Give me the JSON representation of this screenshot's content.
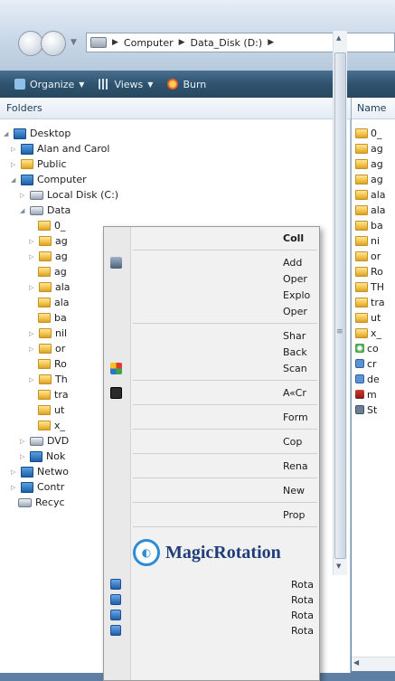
{
  "address": {
    "crumbs": [
      "Computer",
      "Data_Disk (D:)"
    ]
  },
  "toolbar": {
    "organize": "Organize",
    "views": "Views",
    "burn": "Burn"
  },
  "folders": {
    "header": "Folders",
    "tree": [
      {
        "label": "Desktop"
      },
      {
        "label": "Alan and Carol"
      },
      {
        "label": "Public"
      },
      {
        "label": "Computer"
      },
      {
        "label": "Local Disk (C:)"
      },
      {
        "label": "Data"
      },
      {
        "label": "0_"
      },
      {
        "label": "ag"
      },
      {
        "label": "ag"
      },
      {
        "label": "ag"
      },
      {
        "label": "ala"
      },
      {
        "label": "ala"
      },
      {
        "label": "ba"
      },
      {
        "label": "nil"
      },
      {
        "label": "or"
      },
      {
        "label": "Ro"
      },
      {
        "label": "Th"
      },
      {
        "label": "tra"
      },
      {
        "label": "ut"
      },
      {
        "label": "x_"
      },
      {
        "label": "DVD"
      },
      {
        "label": "Nok"
      },
      {
        "label": "Netwo"
      },
      {
        "label": "Contr"
      },
      {
        "label": "Recyc"
      }
    ]
  },
  "files": {
    "header": "Name",
    "rows": [
      "0_",
      "ag",
      "ag",
      "ag",
      "ala",
      "ala",
      "ba",
      "ni",
      "or",
      "Ro",
      "TH",
      "tra",
      "ut",
      "x_",
      "co",
      "cr",
      "de",
      "m",
      "St"
    ]
  },
  "context_menu": {
    "items": [
      "Coll",
      "Add",
      "Oper",
      "Explo",
      "Oper",
      "Shar",
      "Back",
      "Scan",
      "A«Cr",
      "Form",
      "Cop",
      "Rena",
      "New",
      "Prop"
    ],
    "brand": "MagicRotation",
    "rotate_items": [
      "Rota",
      "Rota",
      "Rota",
      "Rota"
    ]
  }
}
